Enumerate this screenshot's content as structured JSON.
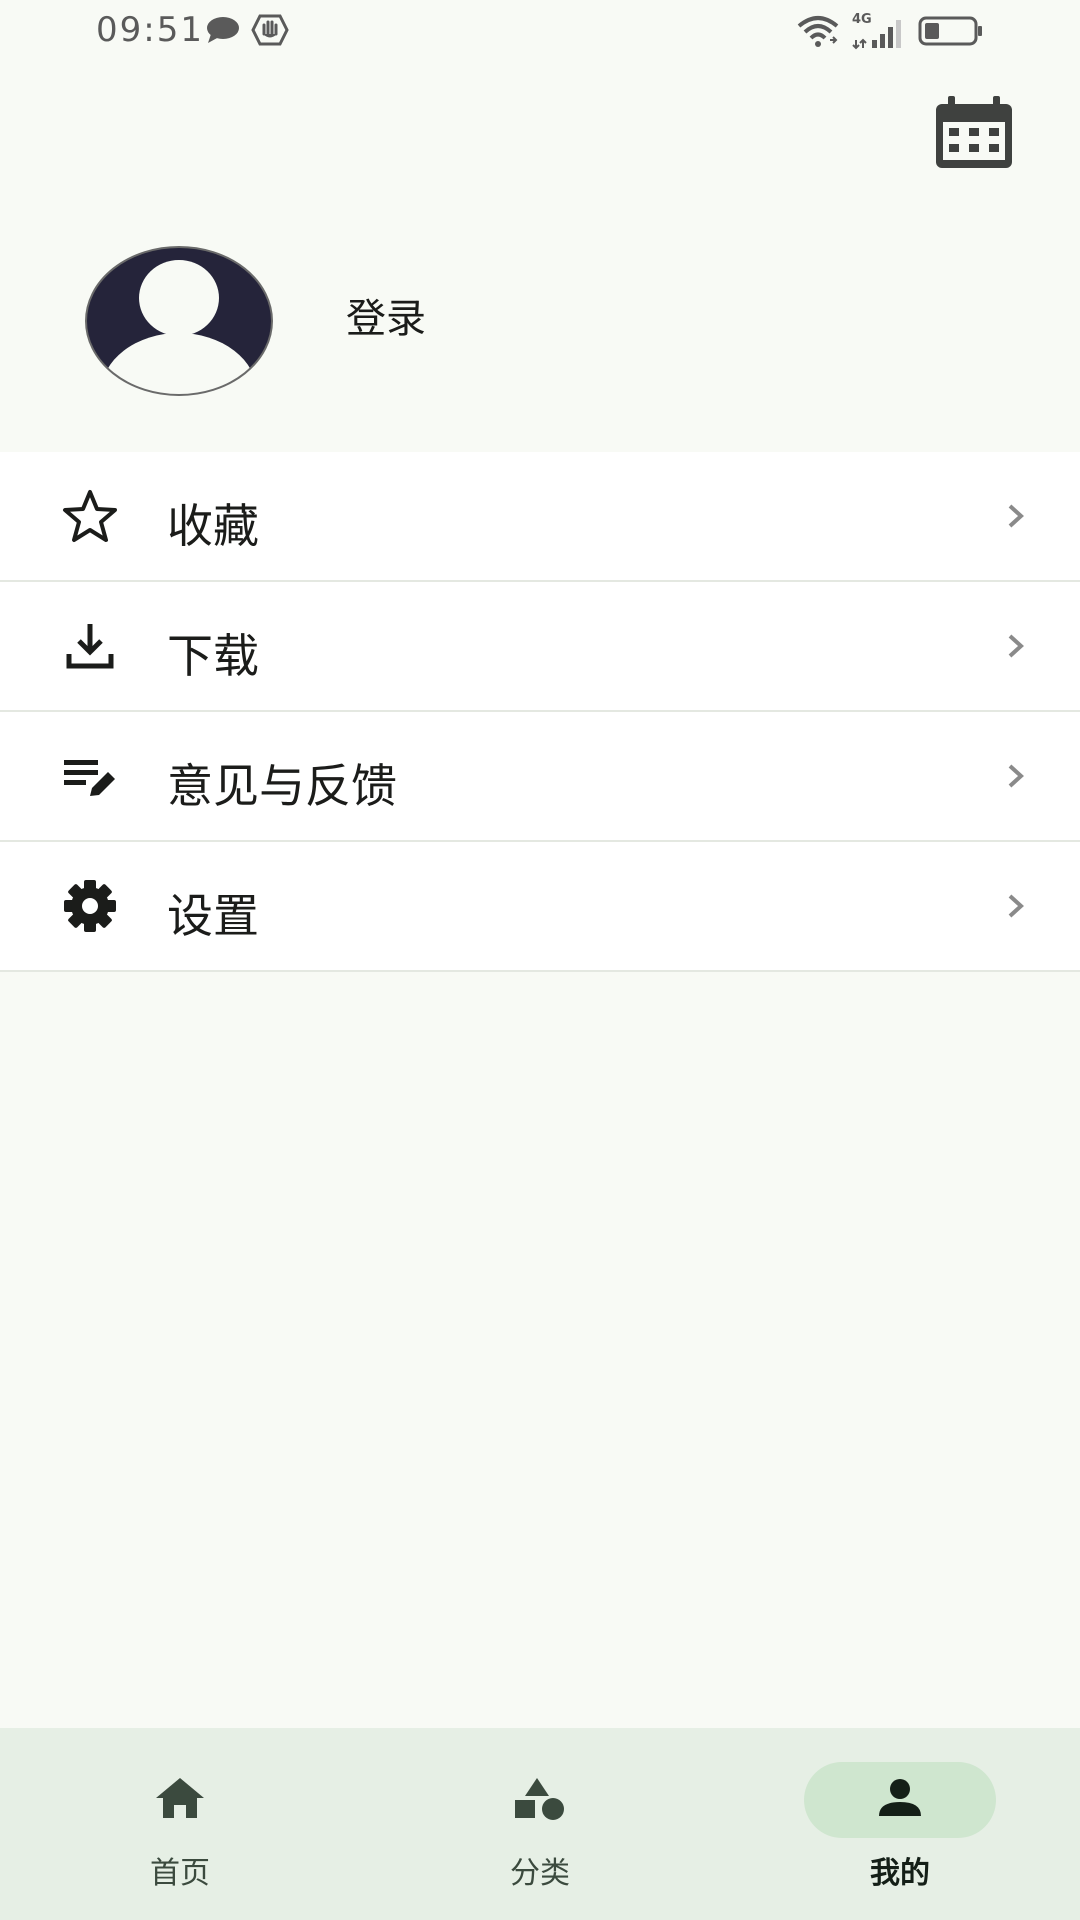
{
  "status_bar": {
    "time": "09:51",
    "network": "4G",
    "icons": [
      "chat-bubble-icon",
      "hand-shield-icon",
      "wifi-icon",
      "signal-icon",
      "battery-icon"
    ]
  },
  "header": {
    "calendar_icon": "calendar-icon"
  },
  "profile": {
    "login_label": "登录",
    "avatar_icon": "person-avatar-icon"
  },
  "menu": {
    "items": [
      {
        "label": "收藏",
        "icon": "star-outline-icon"
      },
      {
        "label": "下载",
        "icon": "download-icon"
      },
      {
        "label": "意见与反馈",
        "icon": "feedback-edit-icon"
      },
      {
        "label": "设置",
        "icon": "gear-icon"
      }
    ]
  },
  "bottom_nav": {
    "items": [
      {
        "label": "首页",
        "icon": "home-icon",
        "active": false
      },
      {
        "label": "分类",
        "icon": "category-shapes-icon",
        "active": false
      },
      {
        "label": "我的",
        "icon": "person-icon",
        "active": true
      }
    ]
  },
  "colors": {
    "background": "#f8faf5",
    "nav_background": "#e6efe5",
    "active_pill": "#cfe6cf",
    "avatar_dark": "#25243a"
  }
}
